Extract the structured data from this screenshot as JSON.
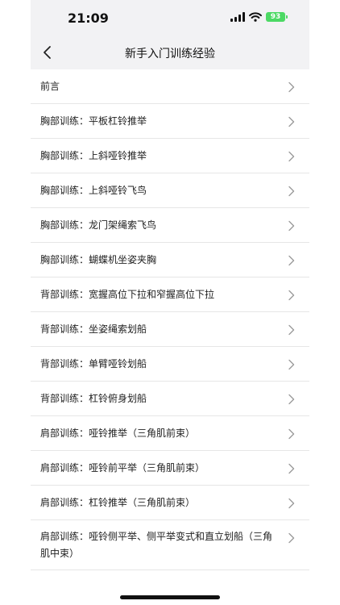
{
  "status_bar": {
    "time": "21:09",
    "battery": "93"
  },
  "nav": {
    "title": "新手入门训练经验"
  },
  "items": [
    {
      "label": "前言"
    },
    {
      "label": "胸部训练：平板杠铃推举"
    },
    {
      "label": "胸部训练：上斜哑铃推举"
    },
    {
      "label": "胸部训练：上斜哑铃飞鸟"
    },
    {
      "label": "胸部训练：龙门架绳索飞鸟"
    },
    {
      "label": "胸部训练：蝴蝶机坐姿夹胸"
    },
    {
      "label": "背部训练：宽握高位下拉和窄握高位下拉"
    },
    {
      "label": "背部训练：坐姿绳索划船"
    },
    {
      "label": "背部训练：单臂哑铃划船"
    },
    {
      "label": "背部训练：杠铃俯身划船"
    },
    {
      "label": "肩部训练：哑铃推举（三角肌前束）"
    },
    {
      "label": "肩部训练：哑铃前平举（三角肌前束）"
    },
    {
      "label": "肩部训练：杠铃推举（三角肌前束）"
    },
    {
      "label": "肩部训练：哑铃侧平举、侧平举变式和直立划船（三角肌中束）"
    }
  ],
  "colors": {
    "battery": "#4cd964",
    "header_bg": "#f2f2f4",
    "divider": "#e6e6e6",
    "chevron": "#9a9a9a"
  },
  "icons": {
    "back": "chevron-left-icon",
    "row": "chevron-right-icon",
    "signal": "signal-icon",
    "wifi": "wifi-icon",
    "battery": "battery-icon"
  }
}
